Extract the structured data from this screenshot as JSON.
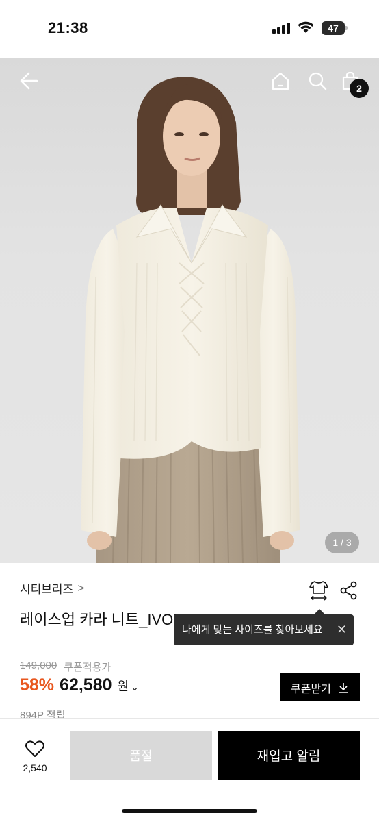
{
  "status_bar": {
    "time": "21:38",
    "battery_level": "47"
  },
  "header": {
    "back_icon": "arrow-left-icon",
    "home_icon": "home-icon",
    "search_icon": "search-icon",
    "cart_icon": "shopping-bag-icon",
    "cart_count": "2"
  },
  "gallery": {
    "pager": "1 / 3"
  },
  "product": {
    "brand": "시티브리즈",
    "brand_chevron": ">",
    "title": "레이스업 카라 니트_IVORY",
    "original_price": "149,000",
    "coupon_note": "쿠폰적용가",
    "discount": "58%",
    "price": "62,580",
    "currency": "원",
    "points": "894P 적립"
  },
  "tooltip": {
    "text": "나에게 맞는 사이즈를 찾아보세요",
    "close": "✕"
  },
  "actions": {
    "coupon_label": "쿠폰받기",
    "like_count": "2,540",
    "soldout_label": "품절",
    "restock_label": "재입고 알림"
  },
  "colors": {
    "accent_discount": "#e8571f",
    "button_dark": "#000000",
    "button_disabled": "#d9d9d9"
  }
}
